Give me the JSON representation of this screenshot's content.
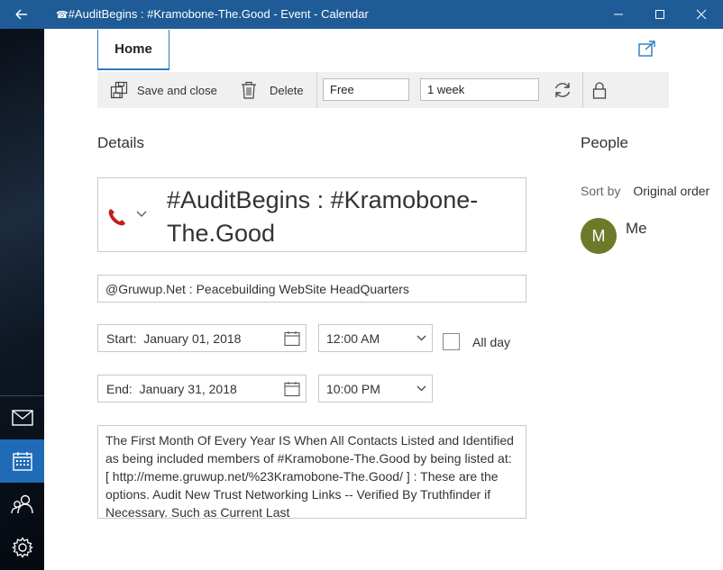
{
  "window": {
    "title_icon": "phone-icon",
    "title": "#AuditBegins : #Kramobone-The.Good - Event - Calendar",
    "phone_glyph": "☎",
    "titlebar_color": "#1f5b96"
  },
  "ribbon": {
    "tab_home": "Home",
    "save_close": "Save and close",
    "delete": "Delete",
    "show_as": "Free",
    "reminder": "1 week"
  },
  "details": {
    "heading": "Details",
    "subject": "#AuditBegins : #Kramobone-The.Good",
    "location": "@Gruwup.Net : Peacebuilding WebSite HeadQuarters",
    "start_label": "Start:",
    "start_date": "January 01, 2018",
    "start_time": "12:00 AM",
    "all_day": "All day",
    "end_label": "End:",
    "end_date": "January 31, 2018",
    "end_time": "10:00 PM",
    "description": "The First Month Of Every Year IS When All Contacts Listed and Identified as being included members of #Kramobone-The.Good by being listed at: [ http://meme.gruwup.net/%23Kramobone-The.Good/ ] : These are the options.  Audit New Trust Networking Links -- Verified By Truthfinder if Necessary.  Such as Current Last"
  },
  "people": {
    "heading": "People",
    "sort_label": "Sort by",
    "sort_value": "Original order",
    "attendees": [
      {
        "initial": "M",
        "name": "Me",
        "color": "#6b7b2a"
      }
    ]
  },
  "sidebar": {
    "items": [
      "mail-icon",
      "calendar-icon",
      "people-icon",
      "settings-icon"
    ],
    "active_color": "#1f6bb8"
  }
}
